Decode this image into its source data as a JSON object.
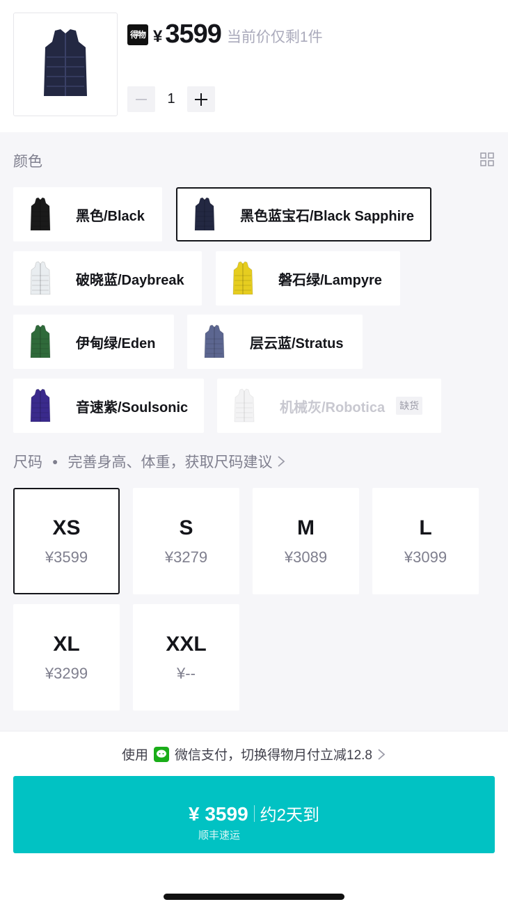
{
  "product": {
    "badge": "得物",
    "currency": "¥",
    "price": "3599",
    "stock_note": "当前价仅剩1件",
    "quantity": "1"
  },
  "color_section": {
    "title": "颜色",
    "options": [
      {
        "label": "黑色/Black",
        "color": "#1a1a1a",
        "selected": false
      },
      {
        "label": "黑色蓝宝石/Black Sapphire",
        "color": "#232842",
        "selected": true
      },
      {
        "label": "破晓蓝/Daybreak",
        "color": "#e9edf0",
        "selected": false
      },
      {
        "label": "磐石绿/Lampyre",
        "color": "#e6cd1f",
        "selected": false
      },
      {
        "label": "伊甸绿/Eden",
        "color": "#2f6a3a",
        "selected": false
      },
      {
        "label": "层云蓝/Stratus",
        "color": "#5c6690",
        "selected": false
      },
      {
        "label": "音速紫/Soulsonic",
        "color": "#3a2a8c",
        "selected": false
      },
      {
        "label": "机械灰/Robotica",
        "color": "#e8e8ea",
        "selected": false,
        "out_of_stock": "缺货"
      }
    ]
  },
  "size_section": {
    "title": "尺码",
    "hint": "完善身高、体重，获取尺码建议",
    "options": [
      {
        "size": "XS",
        "price": "¥3599",
        "selected": true
      },
      {
        "size": "S",
        "price": "¥3279"
      },
      {
        "size": "M",
        "price": "¥3089"
      },
      {
        "size": "L",
        "price": "¥3099"
      },
      {
        "size": "XL",
        "price": "¥3299"
      },
      {
        "size": "XXL",
        "price": "¥--"
      }
    ]
  },
  "payment": {
    "prefix": "使用",
    "text": "微信支付，切换得物月付立减12.8"
  },
  "buy": {
    "price": "¥ 3599",
    "eta": "约2天到",
    "shipping": "顺丰速运",
    "color": "#01c2c3"
  }
}
